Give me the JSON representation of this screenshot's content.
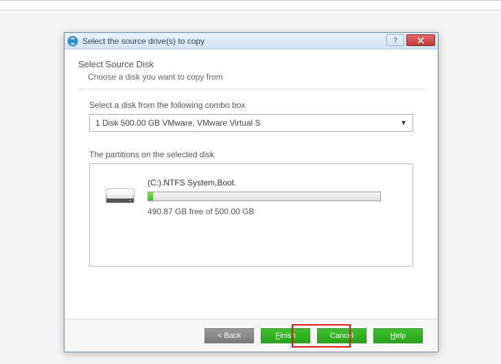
{
  "window": {
    "title": "Select the source drive(s) to copy"
  },
  "page": {
    "heading": "Select Source Disk",
    "subheading": "Choose a disk you want to copy from",
    "combo_label": "Select a disk from the following combo box",
    "combo_value": "1 Disk 500.00 GB VMware,  VMware Virtual S",
    "partitions_label": "The partitions on the selected disk"
  },
  "partition": {
    "name": "(C:).NTFS System,Boot.",
    "free_text": "490.87 GB free of 500.00 GB",
    "used_percent": 2.2
  },
  "buttons": {
    "back": "< Back",
    "finish": "Finish",
    "cancel": "Cancel",
    "help": "Help"
  }
}
